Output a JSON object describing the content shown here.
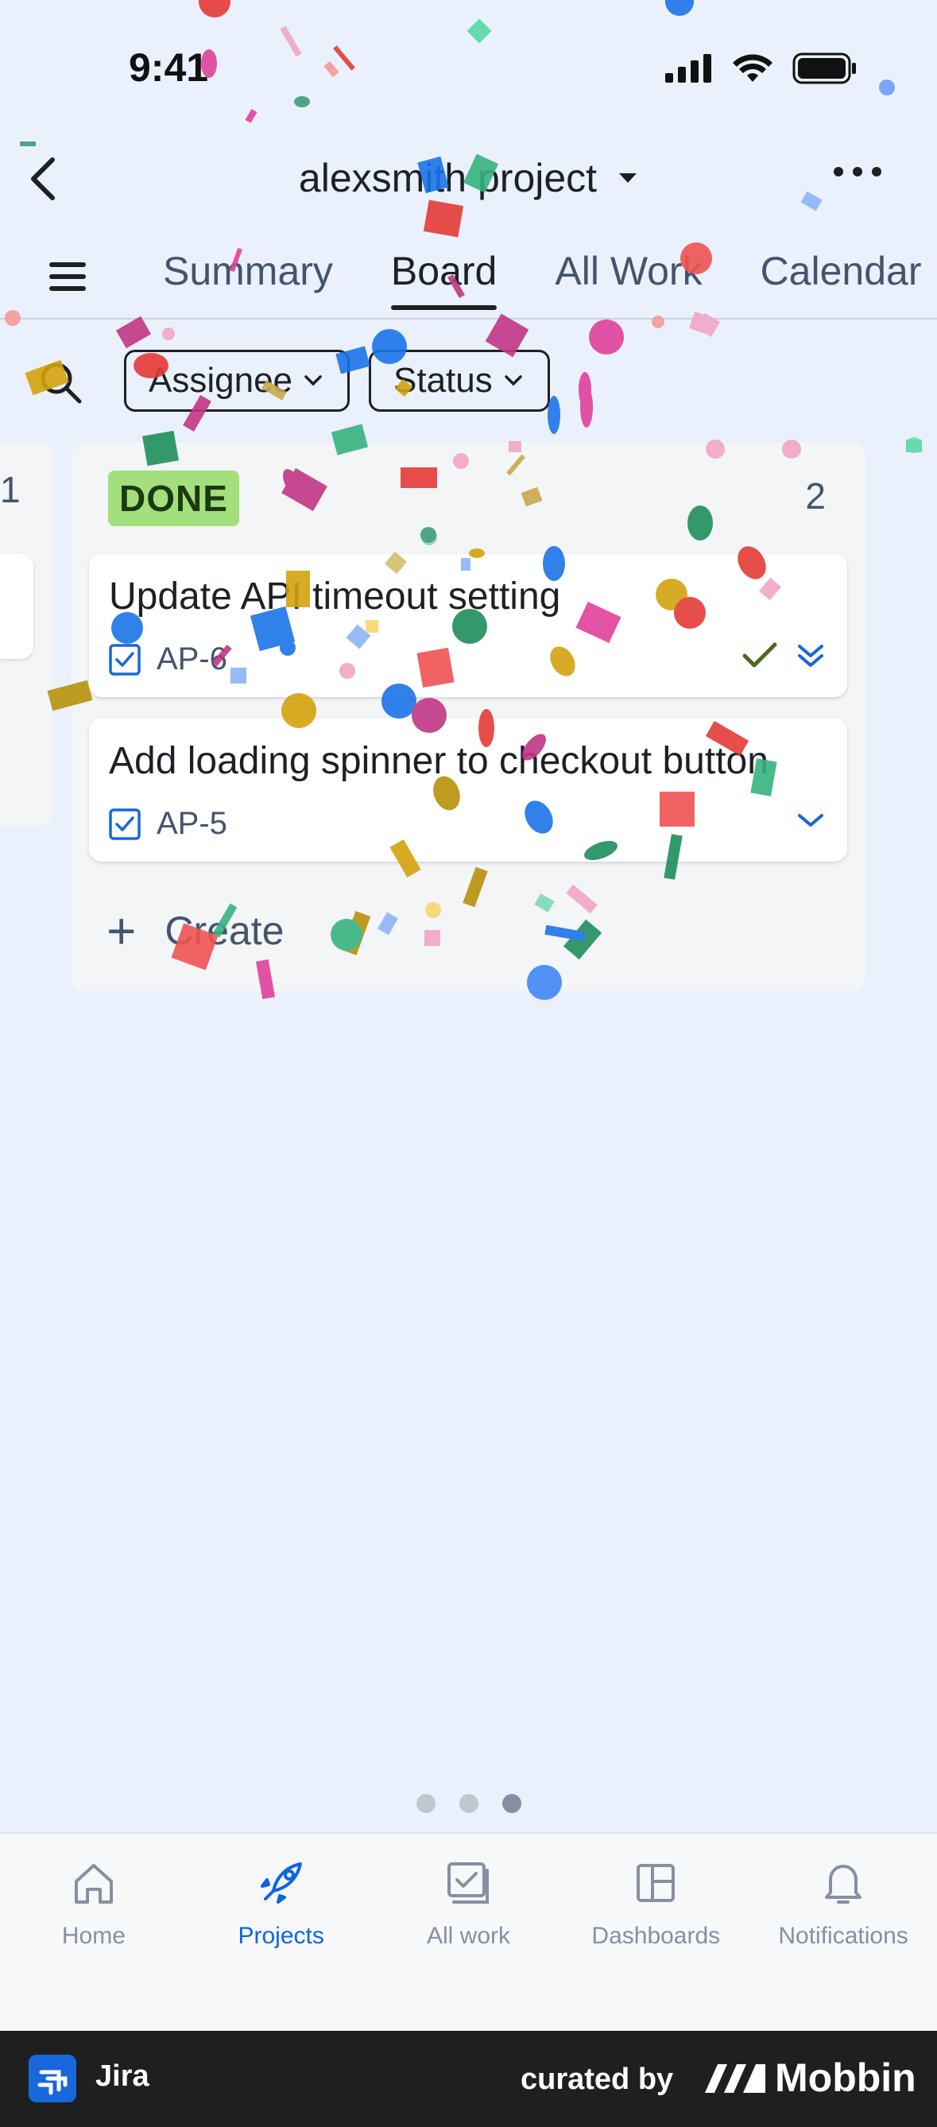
{
  "status_bar": {
    "time": "9:41"
  },
  "header": {
    "title": "alexsmith project"
  },
  "tabs": [
    {
      "label": "Summary",
      "active": false
    },
    {
      "label": "Board",
      "active": true
    },
    {
      "label": "All Work",
      "active": false
    },
    {
      "label": "Calendar",
      "active": false
    }
  ],
  "filters": {
    "assignee": "Assignee",
    "status": "Status"
  },
  "previous_column": {
    "count": "1"
  },
  "column": {
    "status": "DONE",
    "count": "2",
    "cards": [
      {
        "title": "Update API timeout setting",
        "key": "AP-6",
        "icons": [
          "check-icon",
          "priority-lowest-icon"
        ]
      },
      {
        "title": "Add loading spinner to checkout button",
        "key": "AP-5",
        "icons": [
          "priority-low-icon"
        ]
      }
    ],
    "create_label": "Create"
  },
  "page_indicator": {
    "total": 3,
    "current": 3
  },
  "bottom_nav": [
    {
      "label": "Home",
      "icon": "home-icon",
      "active": false
    },
    {
      "label": "Projects",
      "icon": "rocket-icon",
      "active": true
    },
    {
      "label": "All work",
      "icon": "all-work-icon",
      "active": false
    },
    {
      "label": "Dashboards",
      "icon": "dashboard-icon",
      "active": false
    },
    {
      "label": "Notifications",
      "icon": "bell-icon",
      "active": false
    }
  ],
  "footer": {
    "app_name": "Jira",
    "curated_by": "curated by",
    "brand": "Mobbin"
  },
  "colors": {
    "accent": "#0c66e4",
    "done_lozenge": "#a3df7d",
    "background": "#eaf1fd"
  }
}
